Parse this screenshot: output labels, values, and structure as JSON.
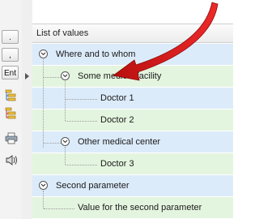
{
  "toolbar": {
    "btn_dot": ".",
    "btn_comma": ",",
    "btn_enter": "Ent",
    "icons": [
      "expand-all-icon",
      "collapse-all-icon",
      "print-icon",
      "sound-icon"
    ]
  },
  "grid": {
    "header": "List of values",
    "rows": [
      {
        "label": "Where and to whom",
        "expander": true
      },
      {
        "label": "Some medical facility",
        "expander": true
      },
      {
        "label": "Doctor 1",
        "expander": false
      },
      {
        "label": "Doctor 2",
        "expander": false
      },
      {
        "label": "Other medical center",
        "expander": true
      },
      {
        "label": "Doctor 3",
        "expander": false
      },
      {
        "label": "Second parameter",
        "expander": true
      },
      {
        "label": "Value for the second parameter",
        "expander": false
      }
    ]
  },
  "colors": {
    "row_blue": "#dcebfa",
    "row_green": "#e4f5df",
    "annotation_arrow": "#e01818"
  }
}
